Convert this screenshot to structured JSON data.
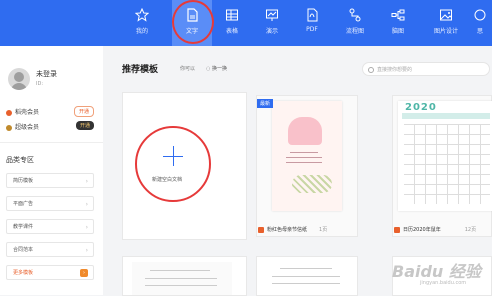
{
  "tabs": [
    {
      "label": "我的",
      "icon": "star-icon"
    },
    {
      "label": "文字",
      "icon": "document-icon",
      "active": true
    },
    {
      "label": "表格",
      "icon": "table-icon"
    },
    {
      "label": "演示",
      "icon": "presentation-icon"
    },
    {
      "label": "PDF",
      "icon": "pdf-icon"
    },
    {
      "label": "流程图",
      "icon": "flowchart-icon"
    },
    {
      "label": "脑图",
      "icon": "mindmap-icon"
    },
    {
      "label": "图片设计",
      "icon": "image-design-icon"
    },
    {
      "label": "思",
      "icon": "more-icon"
    }
  ],
  "user": {
    "name": "未登录",
    "sub": "ID:",
    "vip_label": "稻壳会员",
    "vip_button": "开通",
    "svip_label": "超级会员",
    "svip_button": "开通"
  },
  "category": {
    "title": "品类专区",
    "items": [
      "简历模板",
      "平面广告",
      "教学课件",
      "合同范本",
      "更多模板"
    ]
  },
  "main": {
    "title": "推荐模板",
    "filter": "你可以",
    "swap": "换一换",
    "search_placeholder": "直接搜你想要的"
  },
  "new_doc": {
    "label": "新建空白文档"
  },
  "templates": [
    {
      "badge": "最新",
      "name": "粉红色母亲节信纸",
      "pages": "1页"
    },
    {
      "year": "2020",
      "name": "日历2020年鼠年",
      "pages": "12页"
    }
  ],
  "watermark": {
    "text": "Baidu 经验",
    "sub": "jingyan.baidu.com"
  },
  "colors": {
    "accent": "#2f6cf0",
    "highlight_circle": "#e63a3a",
    "orange": "#e8602c"
  }
}
